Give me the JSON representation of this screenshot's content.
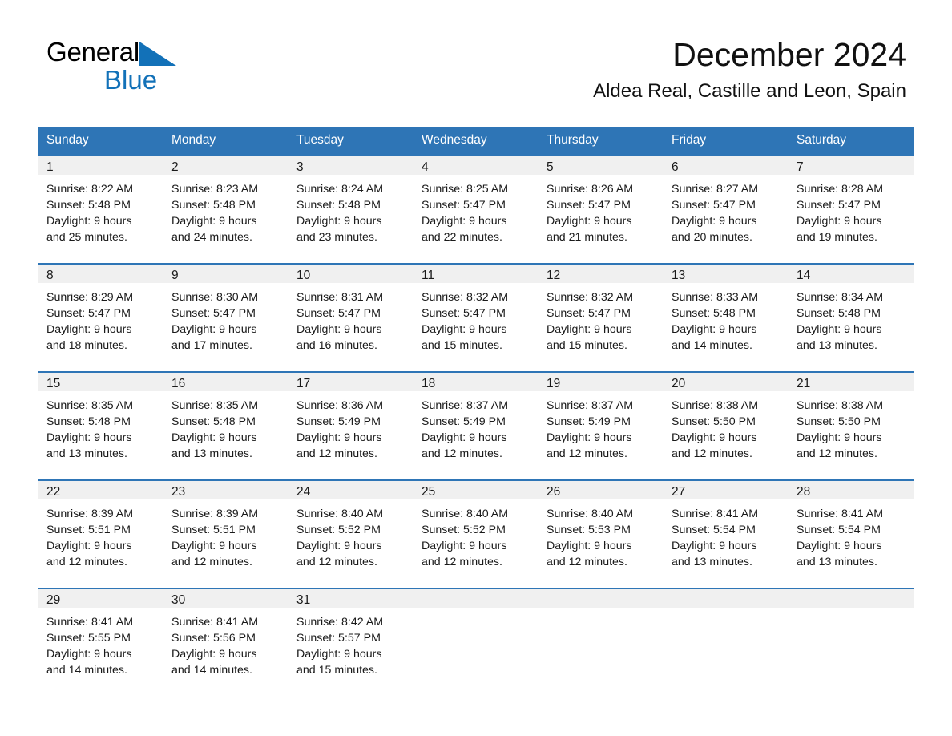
{
  "brand": {
    "name_general": "General",
    "name_blue": "Blue",
    "triangle_color": "#1271b8"
  },
  "header": {
    "title": "December 2024",
    "subtitle": "Aldea Real, Castille and Leon, Spain"
  },
  "colors": {
    "header_blue": "#2e75b6",
    "daynum_gray": "#f0f0f0",
    "logo_blue": "#1271b8"
  },
  "weekday_headers": [
    "Sunday",
    "Monday",
    "Tuesday",
    "Wednesday",
    "Thursday",
    "Friday",
    "Saturday"
  ],
  "weeks": [
    [
      {
        "day": "1",
        "sunrise": "Sunrise: 8:22 AM",
        "sunset": "Sunset: 5:48 PM",
        "daylight1": "Daylight: 9 hours",
        "daylight2": "and 25 minutes."
      },
      {
        "day": "2",
        "sunrise": "Sunrise: 8:23 AM",
        "sunset": "Sunset: 5:48 PM",
        "daylight1": "Daylight: 9 hours",
        "daylight2": "and 24 minutes."
      },
      {
        "day": "3",
        "sunrise": "Sunrise: 8:24 AM",
        "sunset": "Sunset: 5:48 PM",
        "daylight1": "Daylight: 9 hours",
        "daylight2": "and 23 minutes."
      },
      {
        "day": "4",
        "sunrise": "Sunrise: 8:25 AM",
        "sunset": "Sunset: 5:47 PM",
        "daylight1": "Daylight: 9 hours",
        "daylight2": "and 22 minutes."
      },
      {
        "day": "5",
        "sunrise": "Sunrise: 8:26 AM",
        "sunset": "Sunset: 5:47 PM",
        "daylight1": "Daylight: 9 hours",
        "daylight2": "and 21 minutes."
      },
      {
        "day": "6",
        "sunrise": "Sunrise: 8:27 AM",
        "sunset": "Sunset: 5:47 PM",
        "daylight1": "Daylight: 9 hours",
        "daylight2": "and 20 minutes."
      },
      {
        "day": "7",
        "sunrise": "Sunrise: 8:28 AM",
        "sunset": "Sunset: 5:47 PM",
        "daylight1": "Daylight: 9 hours",
        "daylight2": "and 19 minutes."
      }
    ],
    [
      {
        "day": "8",
        "sunrise": "Sunrise: 8:29 AM",
        "sunset": "Sunset: 5:47 PM",
        "daylight1": "Daylight: 9 hours",
        "daylight2": "and 18 minutes."
      },
      {
        "day": "9",
        "sunrise": "Sunrise: 8:30 AM",
        "sunset": "Sunset: 5:47 PM",
        "daylight1": "Daylight: 9 hours",
        "daylight2": "and 17 minutes."
      },
      {
        "day": "10",
        "sunrise": "Sunrise: 8:31 AM",
        "sunset": "Sunset: 5:47 PM",
        "daylight1": "Daylight: 9 hours",
        "daylight2": "and 16 minutes."
      },
      {
        "day": "11",
        "sunrise": "Sunrise: 8:32 AM",
        "sunset": "Sunset: 5:47 PM",
        "daylight1": "Daylight: 9 hours",
        "daylight2": "and 15 minutes."
      },
      {
        "day": "12",
        "sunrise": "Sunrise: 8:32 AM",
        "sunset": "Sunset: 5:47 PM",
        "daylight1": "Daylight: 9 hours",
        "daylight2": "and 15 minutes."
      },
      {
        "day": "13",
        "sunrise": "Sunrise: 8:33 AM",
        "sunset": "Sunset: 5:48 PM",
        "daylight1": "Daylight: 9 hours",
        "daylight2": "and 14 minutes."
      },
      {
        "day": "14",
        "sunrise": "Sunrise: 8:34 AM",
        "sunset": "Sunset: 5:48 PM",
        "daylight1": "Daylight: 9 hours",
        "daylight2": "and 13 minutes."
      }
    ],
    [
      {
        "day": "15",
        "sunrise": "Sunrise: 8:35 AM",
        "sunset": "Sunset: 5:48 PM",
        "daylight1": "Daylight: 9 hours",
        "daylight2": "and 13 minutes."
      },
      {
        "day": "16",
        "sunrise": "Sunrise: 8:35 AM",
        "sunset": "Sunset: 5:48 PM",
        "daylight1": "Daylight: 9 hours",
        "daylight2": "and 13 minutes."
      },
      {
        "day": "17",
        "sunrise": "Sunrise: 8:36 AM",
        "sunset": "Sunset: 5:49 PM",
        "daylight1": "Daylight: 9 hours",
        "daylight2": "and 12 minutes."
      },
      {
        "day": "18",
        "sunrise": "Sunrise: 8:37 AM",
        "sunset": "Sunset: 5:49 PM",
        "daylight1": "Daylight: 9 hours",
        "daylight2": "and 12 minutes."
      },
      {
        "day": "19",
        "sunrise": "Sunrise: 8:37 AM",
        "sunset": "Sunset: 5:49 PM",
        "daylight1": "Daylight: 9 hours",
        "daylight2": "and 12 minutes."
      },
      {
        "day": "20",
        "sunrise": "Sunrise: 8:38 AM",
        "sunset": "Sunset: 5:50 PM",
        "daylight1": "Daylight: 9 hours",
        "daylight2": "and 12 minutes."
      },
      {
        "day": "21",
        "sunrise": "Sunrise: 8:38 AM",
        "sunset": "Sunset: 5:50 PM",
        "daylight1": "Daylight: 9 hours",
        "daylight2": "and 12 minutes."
      }
    ],
    [
      {
        "day": "22",
        "sunrise": "Sunrise: 8:39 AM",
        "sunset": "Sunset: 5:51 PM",
        "daylight1": "Daylight: 9 hours",
        "daylight2": "and 12 minutes."
      },
      {
        "day": "23",
        "sunrise": "Sunrise: 8:39 AM",
        "sunset": "Sunset: 5:51 PM",
        "daylight1": "Daylight: 9 hours",
        "daylight2": "and 12 minutes."
      },
      {
        "day": "24",
        "sunrise": "Sunrise: 8:40 AM",
        "sunset": "Sunset: 5:52 PM",
        "daylight1": "Daylight: 9 hours",
        "daylight2": "and 12 minutes."
      },
      {
        "day": "25",
        "sunrise": "Sunrise: 8:40 AM",
        "sunset": "Sunset: 5:52 PM",
        "daylight1": "Daylight: 9 hours",
        "daylight2": "and 12 minutes."
      },
      {
        "day": "26",
        "sunrise": "Sunrise: 8:40 AM",
        "sunset": "Sunset: 5:53 PM",
        "daylight1": "Daylight: 9 hours",
        "daylight2": "and 12 minutes."
      },
      {
        "day": "27",
        "sunrise": "Sunrise: 8:41 AM",
        "sunset": "Sunset: 5:54 PM",
        "daylight1": "Daylight: 9 hours",
        "daylight2": "and 13 minutes."
      },
      {
        "day": "28",
        "sunrise": "Sunrise: 8:41 AM",
        "sunset": "Sunset: 5:54 PM",
        "daylight1": "Daylight: 9 hours",
        "daylight2": "and 13 minutes."
      }
    ],
    [
      {
        "day": "29",
        "sunrise": "Sunrise: 8:41 AM",
        "sunset": "Sunset: 5:55 PM",
        "daylight1": "Daylight: 9 hours",
        "daylight2": "and 14 minutes."
      },
      {
        "day": "30",
        "sunrise": "Sunrise: 8:41 AM",
        "sunset": "Sunset: 5:56 PM",
        "daylight1": "Daylight: 9 hours",
        "daylight2": "and 14 minutes."
      },
      {
        "day": "31",
        "sunrise": "Sunrise: 8:42 AM",
        "sunset": "Sunset: 5:57 PM",
        "daylight1": "Daylight: 9 hours",
        "daylight2": "and 15 minutes."
      },
      {
        "day": "",
        "sunrise": "",
        "sunset": "",
        "daylight1": "",
        "daylight2": ""
      },
      {
        "day": "",
        "sunrise": "",
        "sunset": "",
        "daylight1": "",
        "daylight2": ""
      },
      {
        "day": "",
        "sunrise": "",
        "sunset": "",
        "daylight1": "",
        "daylight2": ""
      },
      {
        "day": "",
        "sunrise": "",
        "sunset": "",
        "daylight1": "",
        "daylight2": ""
      }
    ]
  ]
}
